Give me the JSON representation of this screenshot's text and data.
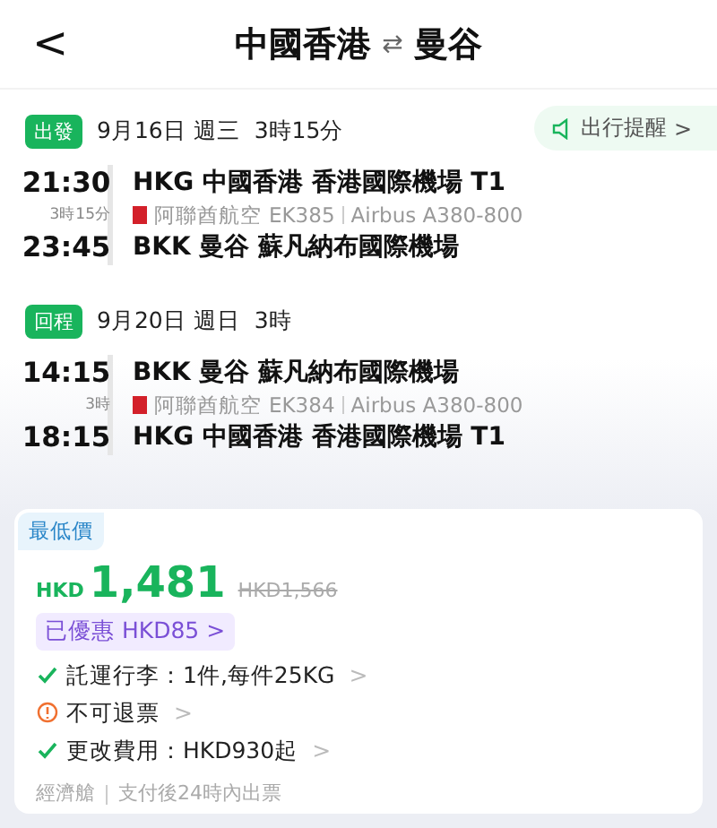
{
  "header": {
    "back": "<",
    "origin": "中國香港",
    "swap": "⇄",
    "destination": "曼谷"
  },
  "reminder": {
    "label": "出行提醒",
    "chevron": ">"
  },
  "segments": [
    {
      "tag": "出發",
      "date": "9月16日 週三",
      "duration": "3時15分",
      "depart_time": "21:30",
      "flight_duration": "3時15分",
      "arrive_time": "23:45",
      "from": "HKG 中國香港 香港國際機場 T1",
      "airline": "阿聯酋航空",
      "flight": "EK385",
      "aircraft": "Airbus A380-800",
      "to": "BKK 曼谷 蘇凡納布國際機場"
    },
    {
      "tag": "回程",
      "date": "9月20日 週日",
      "duration": "3時",
      "depart_time": "14:15",
      "flight_duration": "3時",
      "arrive_time": "18:15",
      "from": "BKK 曼谷 蘇凡納布國際機場",
      "airline": "阿聯酋航空",
      "flight": "EK384",
      "aircraft": "Airbus A380-800",
      "to": "HKG 中國香港 香港國際機場 T1"
    }
  ],
  "fare": {
    "badge": "最低價",
    "currency": "HKD",
    "price": "1,481",
    "original_price": "HKD1,566",
    "discount": "已優惠 HKD85",
    "discount_chevron": ">",
    "policies": [
      {
        "kind": "ok",
        "text": "託運行李：1件,每件25KG",
        "chevron": ">"
      },
      {
        "kind": "warn",
        "text": "不可退票",
        "chevron": ">"
      },
      {
        "kind": "ok",
        "text": "更改費用：HKD930起",
        "chevron": ">"
      }
    ],
    "cabin": "經濟艙",
    "ticketing": "支付後24時內出票"
  }
}
